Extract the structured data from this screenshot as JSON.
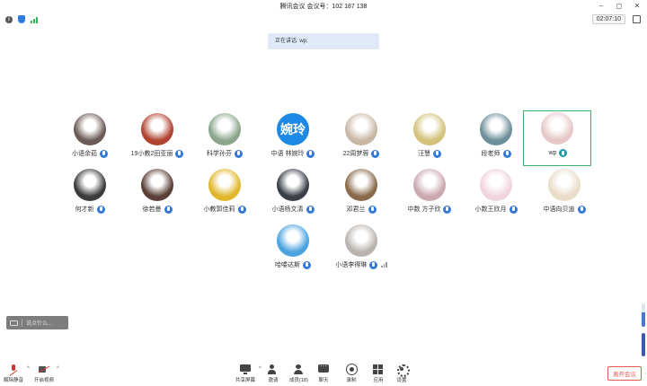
{
  "title": "腾讯会议  会议号：102 187 138",
  "timer": "02:07:10",
  "speaking": "正在讲话: wp;",
  "participants": [
    {
      "name": "小语余茹",
      "avatar": "photo-girl-dark-hair",
      "color": "#6b5a55"
    },
    {
      "name": "19小教2田亚丽",
      "avatar": "photo-red-shirt",
      "color": "#b0432f"
    },
    {
      "name": "科学孙芬",
      "avatar": "photo-outdoor",
      "color": "#8aa58c"
    },
    {
      "name": "中语 林婉玲",
      "avatar_text": "婉玲",
      "color": "#1e88e5"
    },
    {
      "name": "22周梦蓉",
      "avatar": "photo-girl-light",
      "color": "#c9b7a6"
    },
    {
      "name": "汪慧",
      "avatar": "photo-anime",
      "color": "#d2c27a"
    },
    {
      "name": "段老师",
      "avatar": "photo-landscape",
      "color": "#6d8f9a"
    },
    {
      "name": "wp",
      "avatar": "photo-bunny",
      "color": "#e6c8c8",
      "active": true
    },
    {
      "name": "何才新",
      "avatar": "photo-sunglasses",
      "color": "#3c3c3c"
    },
    {
      "name": "徐若曼",
      "avatar": "photo-long-hair",
      "color": "#5a4036"
    },
    {
      "name": "小教郭佳莉",
      "avatar": "photo-yellow-cartoon",
      "color": "#e0b72b"
    },
    {
      "name": "小语杨文清",
      "avatar": "photo-dark-boy",
      "color": "#3a3f47"
    },
    {
      "name": "邓君兰",
      "avatar": "photo-teddy-bear",
      "color": "#8a6a4a"
    },
    {
      "name": "中数 方子欣",
      "avatar": "photo-girl-pink",
      "color": "#caa8b0"
    },
    {
      "name": "小数王欣月",
      "avatar": "photo-anime-pink",
      "color": "#f0d4dc"
    },
    {
      "name": "中语向贝迪",
      "avatar": "photo-cat",
      "color": "#e8dcc8"
    },
    {
      "name": "哈喽达斯",
      "avatar": "photo-doraemon",
      "color": "#4aa3df"
    },
    {
      "name": "小语李得琳",
      "avatar": "photo-sketch-girl",
      "color": "#b9b3ae"
    }
  ],
  "chat_placeholder": "说点什么...",
  "toolbar": {
    "mic_label": "解除静音",
    "camera_label": "开启视频",
    "share_label": "共享屏幕",
    "invite_label": "邀请",
    "members_label": "成员(18)",
    "chat_label": "聊天",
    "record_label": "录制",
    "apps_label": "应用",
    "settings_label": "设置",
    "leave_label": "离开会议"
  },
  "colors": {
    "accent": "#1e88e5",
    "active_border": "#3cb371",
    "leave": "#e05a52",
    "mic_muted": "#d9342b"
  }
}
